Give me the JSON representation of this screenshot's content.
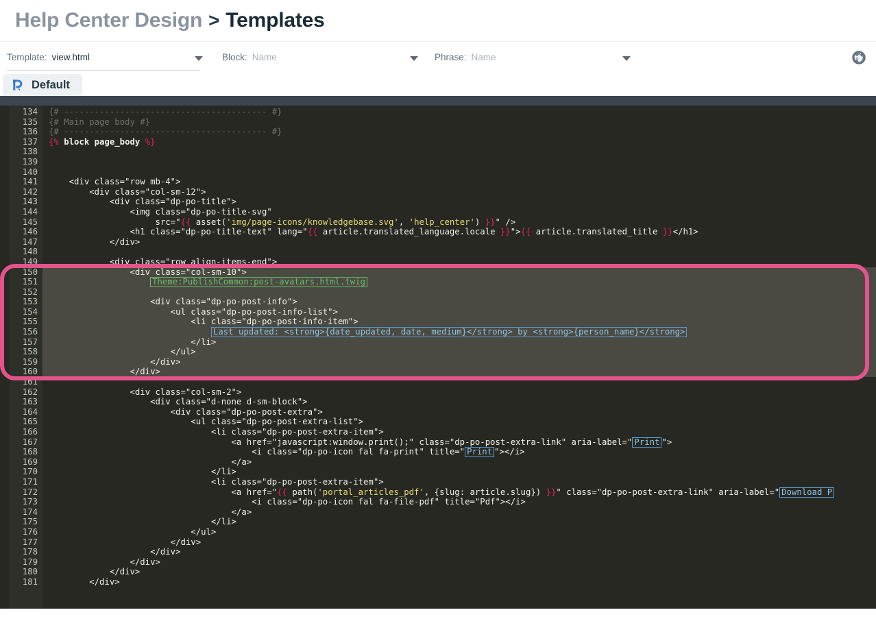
{
  "header": {
    "breadcrumb_parent": "Help Center Design",
    "breadcrumb_separator": ">",
    "breadcrumb_current": "Templates"
  },
  "filters": {
    "template": {
      "label": "Template:",
      "value": "view.html",
      "is_placeholder": false
    },
    "block": {
      "label": "Block:",
      "value": "Name",
      "is_placeholder": true
    },
    "phrase": {
      "label": "Phrase:",
      "value": "Name",
      "is_placeholder": true
    },
    "globe_icon": "globe-icon"
  },
  "tabs": [
    {
      "label": "Default",
      "icon": "deskpro-logo-icon",
      "active": true
    }
  ],
  "editor": {
    "theme_bg": "#272822",
    "gutter_bg": "#2e2f28",
    "highlight_bg": "#4a4a42",
    "annotation_color": "#e3558a",
    "first_visible_line": 134,
    "last_visible_line": 181,
    "partial_top_line": 133,
    "highlight_range": {
      "from": 150,
      "to": 160
    },
    "lines": [
      {
        "n": 134,
        "html": "<span class=\"t-com\">{# ---------------------------------------- #}</span>"
      },
      {
        "n": 135,
        "html": "<span class=\"t-com\">{# Main page body #}</span>"
      },
      {
        "n": 136,
        "html": "<span class=\"t-com\">{# ---------------------------------------- #}</span>"
      },
      {
        "n": 137,
        "html": "<span class=\"t-twig\">{%</span> <span class=\"t-kw\">block</span> <span class=\"t-kw\">page_body</span> <span class=\"t-twig\">%}</span>"
      },
      {
        "n": 138,
        "html": ""
      },
      {
        "n": 139,
        "html": ""
      },
      {
        "n": 140,
        "html": ""
      },
      {
        "n": 141,
        "html": "    &lt;div class=\"row mb-4\"&gt;"
      },
      {
        "n": 142,
        "html": "        &lt;div class=\"col-sm-12\"&gt;"
      },
      {
        "n": 143,
        "html": "            &lt;div class=\"dp-po-title\"&gt;"
      },
      {
        "n": 144,
        "html": "                &lt;img class=\"dp-po-title-svg\""
      },
      {
        "n": 145,
        "html": "                     src=\"<span class=\"t-twig\">{{</span> asset(<span class=\"t-str\">'img/page-icons/knowledgebase.svg'</span>, <span class=\"t-str\">'help_center'</span>) <span class=\"t-twig\">}}</span>\" /&gt;"
      },
      {
        "n": 146,
        "html": "                &lt;h1 class=\"dp-po-title-text\" lang=\"<span class=\"t-twig\">{{</span> article.translated_language.locale <span class=\"t-twig\">}}</span>\"&gt;<span class=\"t-twig\">{{</span> article.translated_title <span class=\"t-twig\">}}</span>&lt;/h1&gt;"
      },
      {
        "n": 147,
        "html": "            &lt;/div&gt;"
      },
      {
        "n": 148,
        "html": ""
      },
      {
        "n": 149,
        "html": "            &lt;div class=\"row align-items-end\"&gt;"
      },
      {
        "n": 150,
        "html": "                &lt;div class=\"col-sm-10\"&gt;"
      },
      {
        "n": 151,
        "html": "                    <span class=\"chip chip-green\">Theme:PublishCommon:post-avatars.html.twig</span>"
      },
      {
        "n": 152,
        "html": ""
      },
      {
        "n": 153,
        "html": "                    &lt;div class=\"dp-po-post-info\"&gt;"
      },
      {
        "n": 154,
        "html": "                        &lt;ul class=\"dp-po-post-info-list\"&gt;"
      },
      {
        "n": 155,
        "html": "                            &lt;li class=\"dp-po-post-info-item\"&gt;"
      },
      {
        "n": 156,
        "html": "                                <span class=\"chip chip-blue\">Last updated: &lt;strong&gt;{date_updated, date, medium}&lt;/strong&gt; by &lt;strong&gt;{person_name}&lt;/strong&gt;</span>"
      },
      {
        "n": 157,
        "html": "                            &lt;/li&gt;"
      },
      {
        "n": 158,
        "html": "                        &lt;/ul&gt;"
      },
      {
        "n": 159,
        "html": "                    &lt;/div&gt;"
      },
      {
        "n": 160,
        "html": "                &lt;/div&gt;"
      },
      {
        "n": 161,
        "html": ""
      },
      {
        "n": 162,
        "html": "                &lt;div class=\"col-sm-2\"&gt;"
      },
      {
        "n": 163,
        "html": "                    &lt;div class=\"d-none d-sm-block\"&gt;"
      },
      {
        "n": 164,
        "html": "                        &lt;div class=\"dp-po-post-extra\"&gt;"
      },
      {
        "n": 165,
        "html": "                            &lt;ul class=\"dp-po-post-extra-list\"&gt;"
      },
      {
        "n": 166,
        "html": "                                &lt;li class=\"dp-po-post-extra-item\"&gt;"
      },
      {
        "n": 167,
        "html": "                                    &lt;a href=\"javascript:window.print();\" class=\"dp-po-post-extra-link\" aria-label=\"<span class=\"chip chip-blue\">Print</span>\"&gt;"
      },
      {
        "n": 168,
        "html": "                                        &lt;i class=\"dp-po-icon fal fa-print\" title=\"<span class=\"chip chip-blue\">Print</span>\"&gt;&lt;/i&gt;"
      },
      {
        "n": 169,
        "html": "                                    &lt;/a&gt;"
      },
      {
        "n": 170,
        "html": "                                &lt;/li&gt;"
      },
      {
        "n": 171,
        "html": "                                &lt;li class=\"dp-po-post-extra-item\"&gt;"
      },
      {
        "n": 172,
        "html": "                                    &lt;a href=\"<span class=\"t-twig\">{{</span> path(<span class=\"t-str\">'portal_articles_pdf'</span>, {slug: article.slug}) <span class=\"t-twig\">}}</span>\" class=\"dp-po-post-extra-link\" aria-label=\"<span class=\"chip chip-blue\">Download P</span>"
      },
      {
        "n": 173,
        "html": "                                        &lt;i class=\"dp-po-icon fal fa-file-pdf\" title=\"Pdf\"&gt;&lt;/i&gt;"
      },
      {
        "n": 174,
        "html": "                                    &lt;/a&gt;"
      },
      {
        "n": 175,
        "html": "                                &lt;/li&gt;"
      },
      {
        "n": 176,
        "html": "                            &lt;/ul&gt;"
      },
      {
        "n": 177,
        "html": "                        &lt;/div&gt;"
      },
      {
        "n": 178,
        "html": "                    &lt;/div&gt;"
      },
      {
        "n": 179,
        "html": "                &lt;/div&gt;"
      },
      {
        "n": 180,
        "html": "            &lt;/div&gt;"
      },
      {
        "n": 181,
        "html": "        &lt;/div&gt;"
      }
    ]
  }
}
